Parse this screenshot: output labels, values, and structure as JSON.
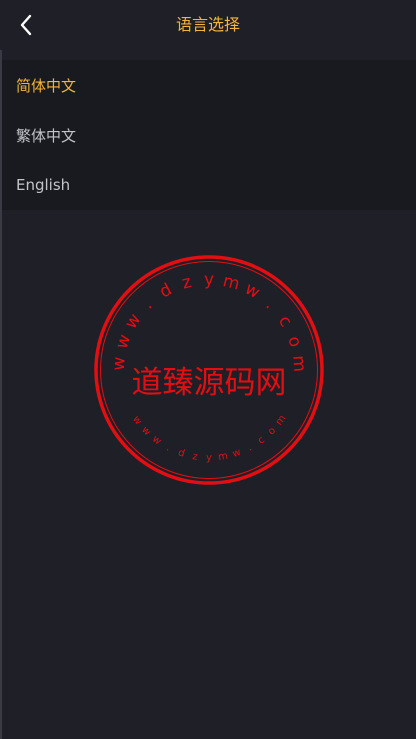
{
  "header": {
    "title": "语言选择",
    "back_icon": "chevron-left-icon"
  },
  "languages": [
    {
      "label": "简体中文",
      "active": true
    },
    {
      "label": "繁体中文",
      "active": false
    },
    {
      "label": "English",
      "active": false
    }
  ],
  "watermark": {
    "center_text": "道臻源码网",
    "top_arc": "www.dzymw.com",
    "bottom_arc": "www.dzymw.com",
    "color": "#e30e12"
  },
  "colors": {
    "accent": "#f3b53b",
    "background": "#1f1f27",
    "list_bg": "#191920",
    "text": "#c3c3ca"
  }
}
